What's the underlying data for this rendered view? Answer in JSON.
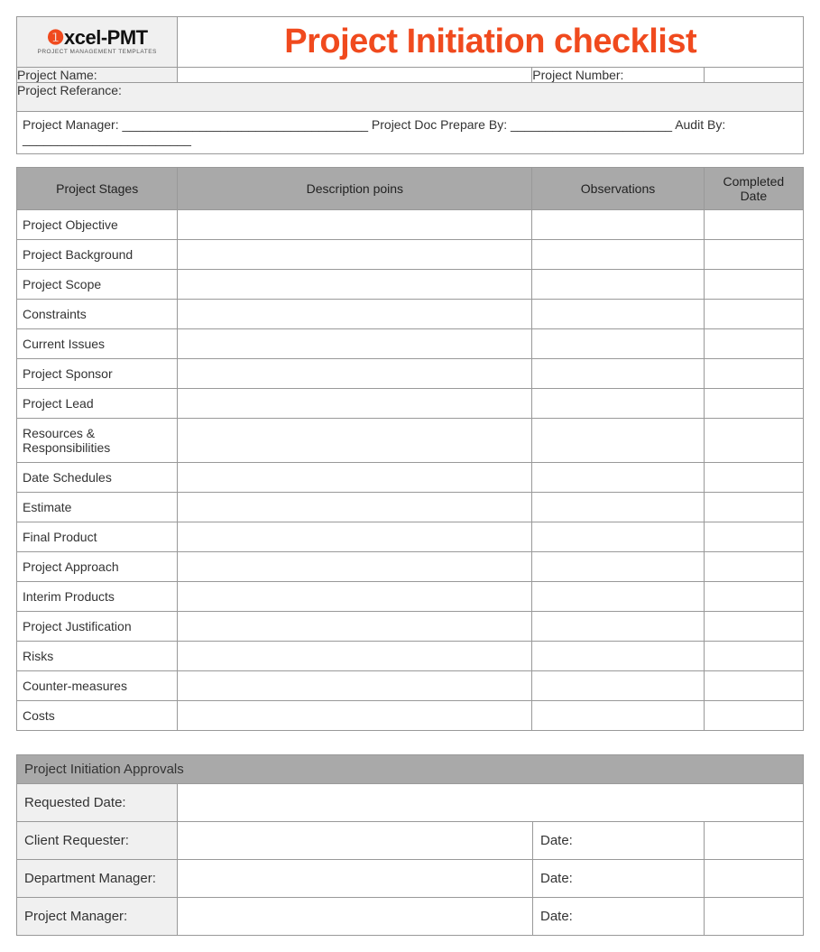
{
  "logo": {
    "text_main_pre": "xcel-",
    "text_main_post": "PMT",
    "sub": "PROJECT MANAGEMENT TEMPLATES"
  },
  "title": "Project Initiation checklist",
  "header": {
    "project_name_label": "Project Name:",
    "project_name_value": "",
    "project_number_label": "Project Number:",
    "project_number_value": "",
    "project_reference_label": "Project Referance:",
    "project_reference_value": "",
    "pm_label": "Project Manager:",
    "doc_prepare_label": "Project Doc Prepare By:",
    "audit_label": "Audit By:",
    "blank_line_pm": "___________________________________",
    "blank_line_doc": "_______________________",
    "blank_line_audit": "________________________"
  },
  "stages_table": {
    "columns": [
      "Project Stages",
      "Description poins",
      "Observations",
      "Completed Date"
    ],
    "rows": [
      {
        "stage": "Project Objective",
        "desc": "",
        "obs": "",
        "date": ""
      },
      {
        "stage": "Project Background",
        "desc": "",
        "obs": "",
        "date": ""
      },
      {
        "stage": "Project Scope",
        "desc": "",
        "obs": "",
        "date": ""
      },
      {
        "stage": "Constraints",
        "desc": "",
        "obs": "",
        "date": ""
      },
      {
        "stage": "Current Issues",
        "desc": "",
        "obs": "",
        "date": ""
      },
      {
        "stage": "Project Sponsor",
        "desc": "",
        "obs": "",
        "date": ""
      },
      {
        "stage": "Project Lead",
        "desc": "",
        "obs": "",
        "date": ""
      },
      {
        "stage": "Resources & Responsibilities",
        "desc": "",
        "obs": "",
        "date": ""
      },
      {
        "stage": "Date Schedules",
        "desc": "",
        "obs": "",
        "date": ""
      },
      {
        "stage": "Estimate",
        "desc": "",
        "obs": "",
        "date": ""
      },
      {
        "stage": "Final Product",
        "desc": "",
        "obs": "",
        "date": ""
      },
      {
        "stage": "Project Approach",
        "desc": "",
        "obs": "",
        "date": ""
      },
      {
        "stage": "Interim Products",
        "desc": "",
        "obs": "",
        "date": ""
      },
      {
        "stage": "Project Justification",
        "desc": "",
        "obs": "",
        "date": ""
      },
      {
        "stage": "Risks",
        "desc": "",
        "obs": "",
        "date": ""
      },
      {
        "stage": "Counter-measures",
        "desc": "",
        "obs": "",
        "date": ""
      },
      {
        "stage": "Costs",
        "desc": "",
        "obs": "",
        "date": ""
      }
    ]
  },
  "approvals": {
    "heading": "Project Initiation Approvals",
    "requested_date_label": "Requested Date:",
    "requested_date_value": "",
    "rows": [
      {
        "label": "Client Requester:",
        "value": "",
        "date_label": "Date:",
        "date_value": ""
      },
      {
        "label": "Department Manager:",
        "value": "",
        "date_label": "Date:",
        "date_value": ""
      },
      {
        "label": "Project Manager:",
        "value": "",
        "date_label": "Date:",
        "date_value": ""
      }
    ]
  }
}
